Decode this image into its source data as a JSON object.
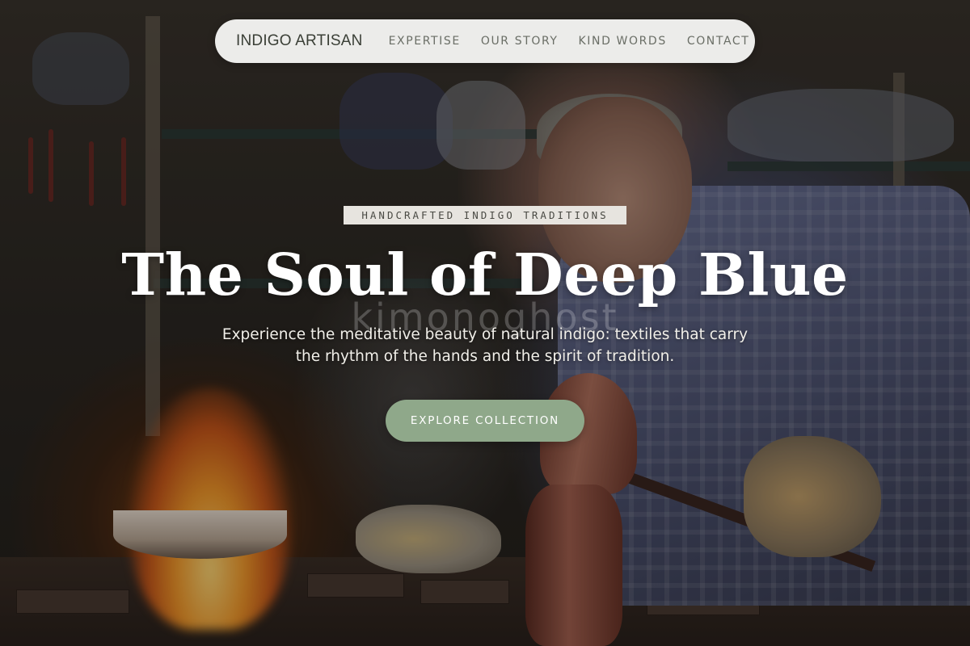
{
  "navbar": {
    "brand": "INDIGO ARTISAN",
    "links": [
      "EXPERTISE",
      "OUR STORY",
      "KIND WORDS",
      "CONTACT"
    ]
  },
  "hero": {
    "eyebrow": "HANDCRAFTED INDIGO TRADITIONS",
    "title": "The Soul of Deep Blue",
    "subtitle": "Experience the meditative beauty of natural indigo: textiles that carry the rhythm of the hands and the spirit of tradition.",
    "cta_label": "EXPLORE COLLECTION",
    "watermark": "kimonoghost"
  },
  "colors": {
    "navbar_bg": "#ececea",
    "brand_text": "#3a3f36",
    "nav_link": "#6a6e66",
    "cta_bg": "#8fa88a",
    "eyebrow_bg": "#e7e4df"
  }
}
